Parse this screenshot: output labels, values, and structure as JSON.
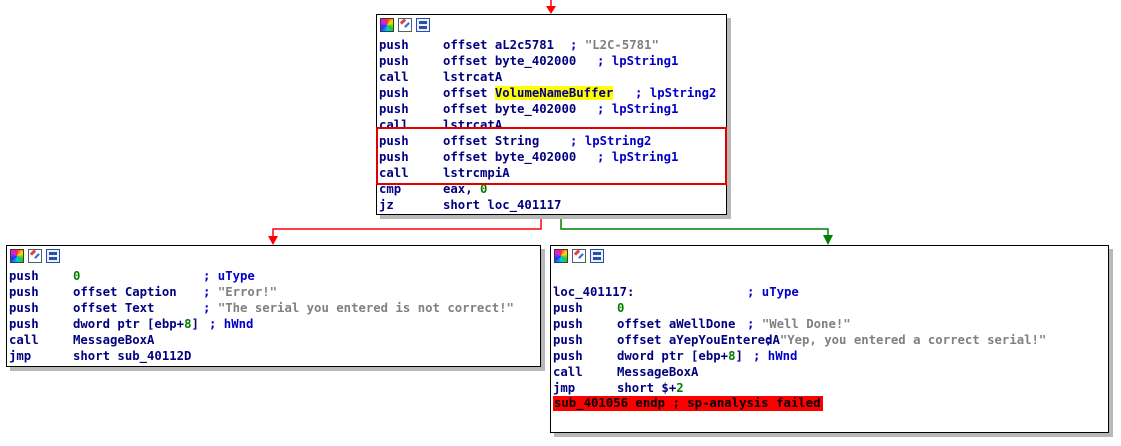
{
  "top_block": {
    "rows": [
      {
        "mnemonic": "push",
        "operand": "offset aL2c5781",
        "comment": "; \"L2C-5781\""
      },
      {
        "mnemonic": "push",
        "operand": "offset byte_402000",
        "comment": "; lpString1"
      },
      {
        "mnemonic": "call",
        "operand": "lstrcatA",
        "comment": ""
      },
      {
        "mnemonic": "push",
        "operand_prefix": "offset",
        "operand_highlight": "VolumeNameBuffer",
        "comment": "; lpString2"
      },
      {
        "mnemonic": "push",
        "operand": "offset byte_402000",
        "comment": "; lpString1"
      },
      {
        "mnemonic": "call",
        "operand": "lstrcatA",
        "comment": ""
      },
      {
        "mnemonic": "push",
        "operand": "offset String",
        "comment": "; lpString2"
      },
      {
        "mnemonic": "push",
        "operand": "offset byte_402000",
        "comment": "; lpString1"
      },
      {
        "mnemonic": "call",
        "operand": "lstrcmpiA",
        "comment": ""
      },
      {
        "mnemonic": "cmp",
        "operand": "eax, ",
        "operand_num": "0",
        "comment": ""
      },
      {
        "mnemonic": "jz",
        "operand": "short loc_401117",
        "comment": ""
      }
    ]
  },
  "left_block": {
    "rows": [
      {
        "mnemonic": "push",
        "operand_num": "0",
        "comment": "; uType"
      },
      {
        "mnemonic": "push",
        "operand": "offset Caption",
        "comment": "; \"Error!\""
      },
      {
        "mnemonic": "push",
        "operand": "offset Text",
        "comment": "; \"The serial you entered is not correct!\""
      },
      {
        "mnemonic": "push",
        "operand": "dword ptr [ebp+",
        "operand_num": "8",
        "operand_end": "]",
        "comment": "; hWnd"
      },
      {
        "mnemonic": "call",
        "operand": "MessageBoxA",
        "comment": ""
      },
      {
        "mnemonic": "jmp",
        "operand": "short sub_40112D",
        "comment": ""
      }
    ]
  },
  "right_block": {
    "label": "loc_401117:",
    "label_comment": "; uType",
    "rows": [
      {
        "mnemonic": "push",
        "operand_num": "0",
        "comment": ""
      },
      {
        "mnemonic": "push",
        "operand": "offset aWellDone",
        "comment": "; \"Well Done!\""
      },
      {
        "mnemonic": "push",
        "operand": "offset aYepYouEnteredA",
        "comment": "; \"Yep, you entered a correct serial!\""
      },
      {
        "mnemonic": "push",
        "operand": "dword ptr [ebp+",
        "operand_num": "8",
        "operand_end": "]",
        "comment": "; hWnd"
      },
      {
        "mnemonic": "call",
        "operand": "MessageBoxA",
        "comment": ""
      },
      {
        "mnemonic": "jmp",
        "operand": "short $+",
        "operand_num": "2",
        "comment": ""
      }
    ],
    "error_line": "sub_401056 endp ; sp-analysis failed"
  },
  "icons": [
    "color-icon",
    "edit-icon",
    "graph-icon"
  ],
  "colors": {
    "false_edge": "#ff0000",
    "true_edge": "#008000",
    "highlight": "#ffff00",
    "error_bg": "#ff0000",
    "selection": "#e00000"
  }
}
